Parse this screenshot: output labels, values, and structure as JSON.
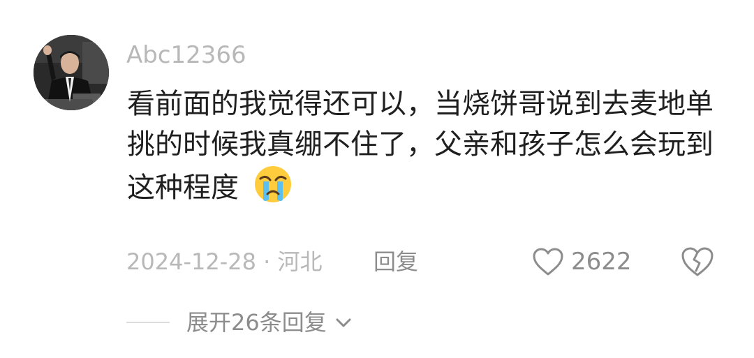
{
  "comment": {
    "username": "Abc12366",
    "text": "看前面的我觉得还可以，当烧饼哥说到去麦地单挑的时候我真绷不住了，父亲和孩子怎么会玩到这种程度",
    "emoji": "crying-face",
    "meta": "2024-12-28 · 河北",
    "reply_label": "回复",
    "like_count": "2622",
    "expand_label": "展开26条回复"
  },
  "colors": {
    "text_primary": "#1f1f1f",
    "text_secondary": "#8c8c8c",
    "text_tertiary": "#b8b8b8"
  }
}
